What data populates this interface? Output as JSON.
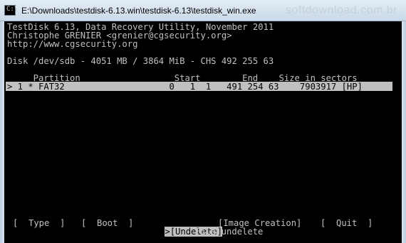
{
  "window": {
    "title": "E:\\Downloads\\testdisk-6.13.win\\testdisk-6.13\\testdisk_win.exe",
    "watermark": "softdownload.com.br"
  },
  "console": {
    "header_line1": "TestDisk 6.13, Data Recovery Utility, November 2011",
    "header_line2": "Christophe GRENIER <grenier@cgsecurity.org>",
    "header_line3": "http://www.cgsecurity.org",
    "disk_info": "Disk /dev/sdb - 4051 MB / 3864 MiB - CHS 492 255 63",
    "table_header": "     Partition                  Start        End    Size in sectors",
    "selected_row": "> 1 * FAT32                    0   1  1   491 254 63    7903917 [HP]",
    "menu": {
      "type": "[  Type  ]",
      "boot": "[  Boot  ]",
      "undelete": ">[Undelete]",
      "image_creation": "[Image Creation]",
      "quit": "[  Quit  ]"
    },
    "status": "File undelete"
  }
}
